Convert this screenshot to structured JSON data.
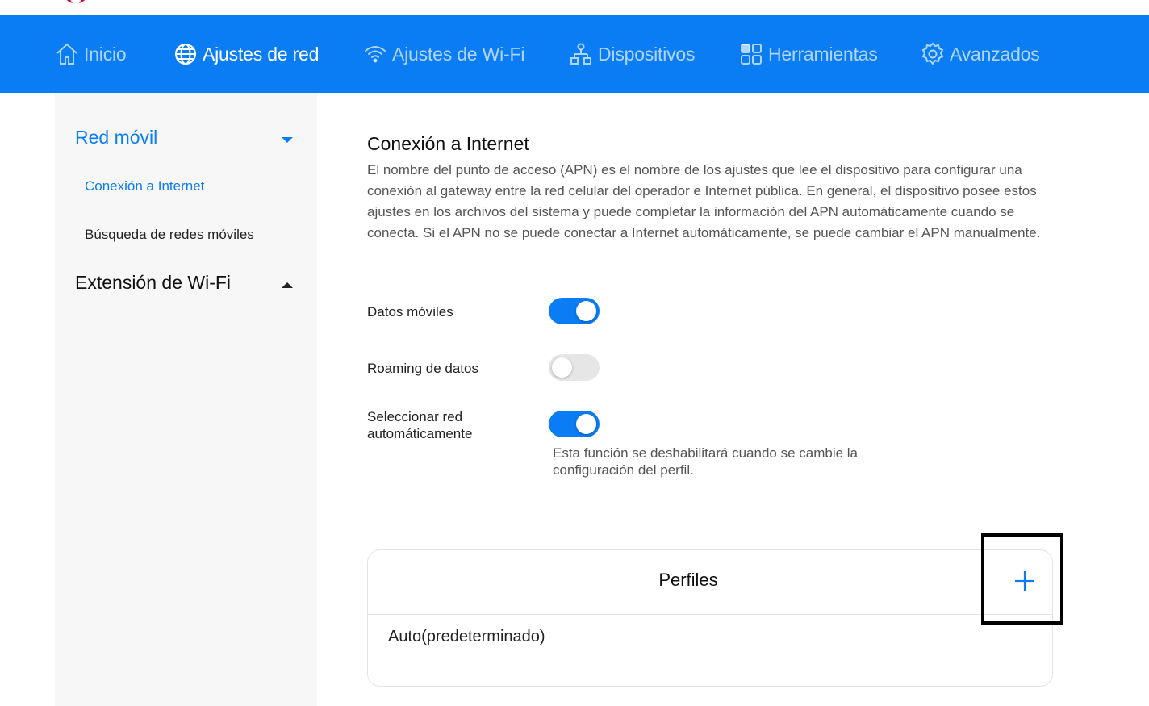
{
  "colors": {
    "accent": "#0a7cf4",
    "toggle_off": "#e6e6e6",
    "logo": "#cf0a2c"
  },
  "top_icons": [
    "logo-icon",
    "account-icon",
    "help-icon",
    "message-icon",
    "settings-icon"
  ],
  "nav": {
    "items": [
      {
        "label": "Inicio",
        "icon": "home-icon",
        "active": false
      },
      {
        "label": "Ajustes de red",
        "icon": "globe-icon",
        "active": true
      },
      {
        "label": "Ajustes de Wi-Fi",
        "icon": "wifi-icon",
        "active": false
      },
      {
        "label": "Dispositivos",
        "icon": "devices-icon",
        "active": false
      },
      {
        "label": "Herramientas",
        "icon": "tools-icon",
        "active": false
      },
      {
        "label": "Avanzados",
        "icon": "gear-icon",
        "active": false
      }
    ]
  },
  "sidebar": {
    "groups": [
      {
        "label": "Red móvil",
        "expanded": true,
        "items": [
          {
            "label": "Conexión a Internet",
            "active": true
          },
          {
            "label": "Búsqueda de redes móviles",
            "active": false
          }
        ]
      },
      {
        "label": "Extensión de Wi-Fi",
        "expanded": false,
        "items": []
      }
    ]
  },
  "main": {
    "title": "Conexión a Internet",
    "description": "El nombre del punto de acceso (APN) es el nombre de los ajustes que lee el dispositivo para configurar una conexión al gateway entre la red celular del operador e Internet pública. En general, el dispositivo posee estos ajustes en los archivos del sistema y puede completar la información del APN automáticamente cuando se conecta. Si el APN no se puede conectar a Internet automáticamente, se puede cambiar el APN manualmente.",
    "settings": [
      {
        "label": "Datos móviles",
        "enabled": true
      },
      {
        "label": "Roaming de datos",
        "enabled": false
      },
      {
        "label": "Seleccionar red automáticamente",
        "enabled": true
      }
    ],
    "auto_select_note": "Esta función se deshabilitará cuando se cambie la configuración del perfil.",
    "profiles": {
      "title": "Perfiles",
      "add_icon": "plus-icon",
      "items": [
        "Auto(predeterminado)"
      ]
    }
  }
}
